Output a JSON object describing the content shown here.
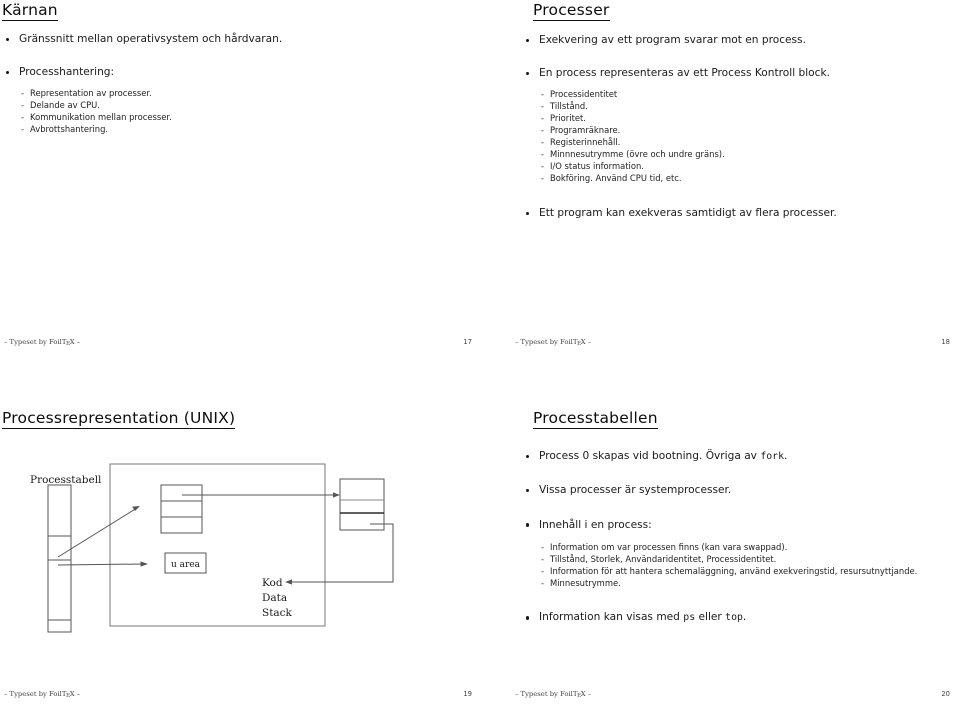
{
  "document": {
    "kind": "lecture-slide-handout",
    "slides_visible": 4
  },
  "slides": [
    {
      "id": "slide-17",
      "title": "Kärnan",
      "bullets": [
        {
          "text": "Gränssnitt mellan operativsystem och hårdvaran.",
          "subs": []
        },
        {
          "text": "Processhantering:",
          "subs": [
            "Representation av processer.",
            "Delande av CPU.",
            "Kommunikation mellan processer.",
            "Avbrottshantering."
          ]
        }
      ],
      "footer": {
        "typeset": "– Typeset by FoilTEX –",
        "page": "17"
      }
    },
    {
      "id": "slide-18",
      "title": "Processer",
      "bullets": [
        {
          "text": "Exekvering av ett program svarar mot en process.",
          "subs": []
        },
        {
          "text": "En process representeras av ett Process Kontroll block.",
          "subs": [
            "Processidentitet",
            "Tillstånd.",
            "Prioritet.",
            "Programräknare.",
            "Registerinnehåll.",
            "Minnnesutrymme (övre och undre gräns).",
            "I/O status information.",
            "Bokföring. Använd CPU tid, etc."
          ]
        },
        {
          "text": "Ett program kan exekveras samtidigt av flera processer.",
          "subs": []
        }
      ],
      "footer": {
        "typeset": "– Typeset by FoilTEX –",
        "page": "18"
      }
    },
    {
      "id": "slide-19",
      "title": "Processrepresentation (UNIX)",
      "diagram": {
        "labels": {
          "process_table": "Processtabell",
          "u_area": "u area",
          "kod": "Kod",
          "data": "Data",
          "stack": "Stack"
        }
      },
      "footer": {
        "typeset": "– Typeset by FoilTEX –",
        "page": "19"
      }
    },
    {
      "id": "slide-20",
      "title": "Processtabellen",
      "bullets": [
        {
          "parts": [
            {
              "t": "Process 0 skapas vid bootning. Övriga av ",
              "mono": false
            },
            {
              "t": "fork",
              "mono": true
            },
            {
              "t": ".",
              "mono": false
            }
          ],
          "subs": []
        },
        {
          "parts": [
            {
              "t": "Vissa processer är systemprocesser.",
              "mono": false
            }
          ],
          "subs": []
        },
        {
          "parts": [
            {
              "t": "Innehåll i en process:",
              "mono": false
            }
          ],
          "subs": [
            "Information om var processen finns (kan vara swappad).",
            "Tillstånd, Storlek, Användaridentitet, Processidentitet.",
            "Information för att hantera schemaläggning, använd exekveringstid, resursutnyttjande.",
            "Minnesutrymme."
          ]
        },
        {
          "parts": [
            {
              "t": "Information kan visas med ",
              "mono": false
            },
            {
              "t": "ps",
              "mono": true
            },
            {
              "t": " eller ",
              "mono": false
            },
            {
              "t": "top",
              "mono": true
            },
            {
              "t": ".",
              "mono": false
            }
          ],
          "subs": []
        }
      ],
      "footer": {
        "typeset": "– Typeset by FoilTEX –",
        "page": "20"
      }
    }
  ],
  "colors": {
    "text": "#1a1a1a",
    "rule": "#0d0d0d",
    "diagram_stroke": "#555555",
    "diagram_stroke_dark": "#2b2b2b",
    "footer_text": "#444444",
    "background": "#ffffff"
  }
}
